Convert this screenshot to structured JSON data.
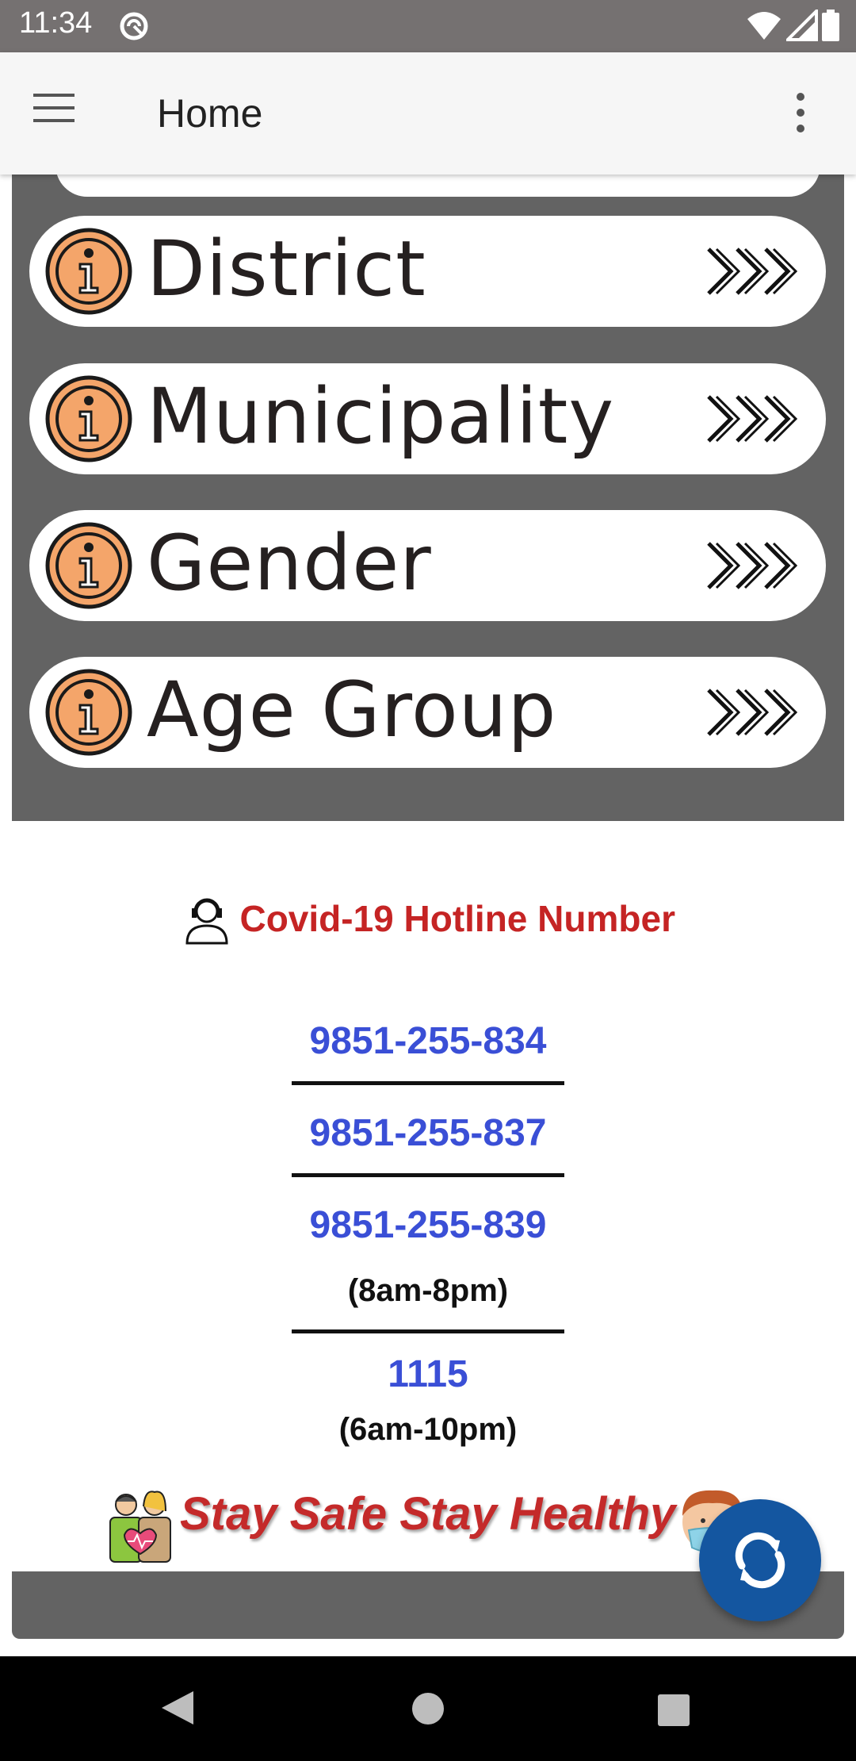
{
  "status_bar": {
    "time": "11:34"
  },
  "app_bar": {
    "title": "Home"
  },
  "nav_items": [
    {
      "label": "District"
    },
    {
      "label": "Municipality"
    },
    {
      "label": "Gender"
    },
    {
      "label": "Age Group"
    }
  ],
  "hotline": {
    "title": "Covid-19 Hotline Number",
    "numbers": [
      "9851-255-834",
      "9851-255-837",
      "9851-255-839",
      "1115"
    ],
    "hours_1": "(8am-8pm)",
    "hours_2": "(6am-10pm)"
  },
  "slogan": "Stay Safe Stay Healthy",
  "colors": {
    "status_bar": "#757171",
    "card_area": "#636363",
    "hotline_title": "#c52424",
    "phone": "#3a4fd6",
    "fab": "#1456a0",
    "info_icon": "#f4a56a"
  },
  "icons": {
    "menu": "hamburger-icon",
    "overflow": "more-vert-icon",
    "info": "info-icon",
    "chevrons": "triple-chevron-icon",
    "refresh": "refresh-icon"
  }
}
